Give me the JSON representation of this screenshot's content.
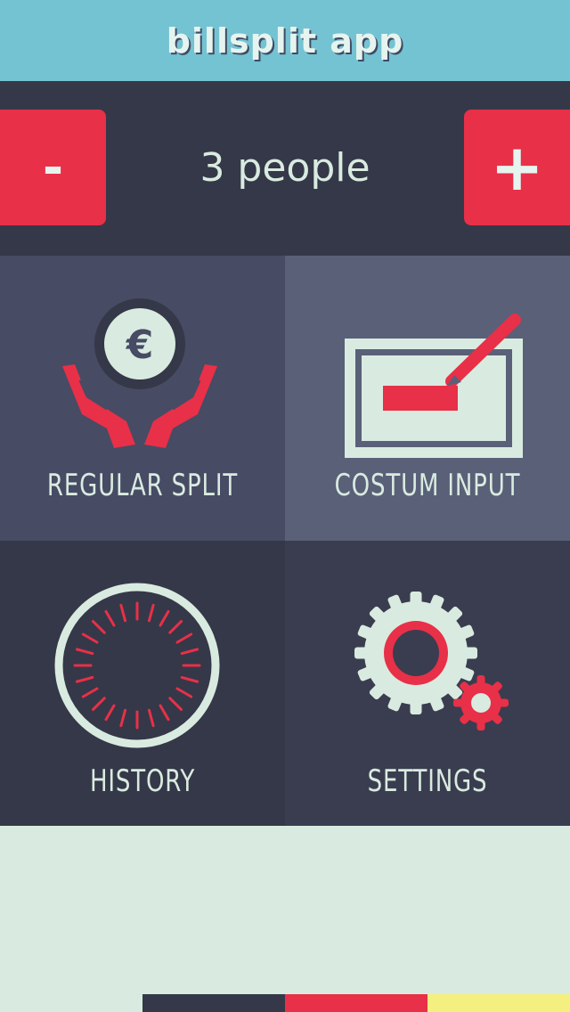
{
  "header": {
    "title": "billsplit app"
  },
  "counter": {
    "minus_label": "-",
    "plus_label": "+",
    "people_text": "3 people"
  },
  "tiles": {
    "regular_split": {
      "label": "REGULAR SPLIT",
      "icon": "euro-hands-icon",
      "currency_symbol": "€"
    },
    "custom_input": {
      "label": "COSTUM INPUT",
      "icon": "pen-input-icon"
    },
    "history": {
      "label": "HISTORY",
      "icon": "clock-icon"
    },
    "settings": {
      "label": "SETTINGS",
      "icon": "gears-icon"
    }
  },
  "colors": {
    "header_bg": "#74c3d3",
    "dark_bg": "#353848",
    "accent_red": "#e83048",
    "light_text": "#d9ebe0",
    "tile_regular_bg": "#474b64",
    "tile_custom_bg": "#596078",
    "footer_yellow": "#f3f080"
  }
}
